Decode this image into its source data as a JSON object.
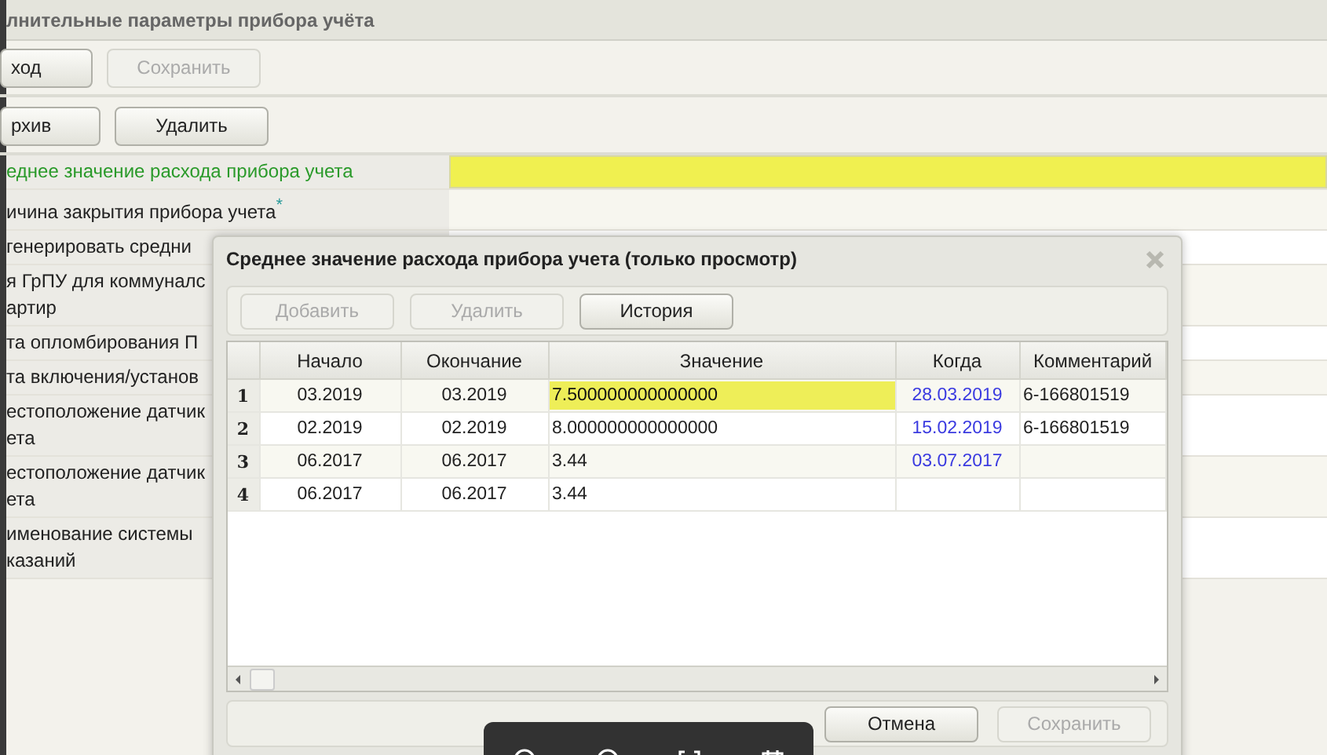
{
  "window": {
    "title": "лнительные параметры прибора учёта"
  },
  "toolbar": [
    {
      "label": "ход",
      "disabled": false
    },
    {
      "label": "Сохранить",
      "disabled": true
    }
  ],
  "toolbar2": [
    {
      "label": "рхив",
      "disabled": false
    },
    {
      "label": "Удалить",
      "disabled": false
    }
  ],
  "properties": [
    {
      "lines": [
        "еднее значение расхода прибора учета"
      ],
      "highlighted": true
    },
    {
      "lines": [
        "ичина закрытия прибора учета"
      ],
      "mark": "*",
      "highlighted": false
    },
    {
      "lines": [
        "генерировать средни"
      ],
      "highlighted": false
    },
    {
      "lines": [
        "я ГрПУ для коммуналс",
        "артир"
      ],
      "highlighted": false
    },
    {
      "lines": [
        "та опломбирования П"
      ],
      "highlighted": false
    },
    {
      "lines": [
        "та включения/установ"
      ],
      "highlighted": false
    },
    {
      "lines": [
        "естоположение датчик",
        "ета"
      ],
      "highlighted": false
    },
    {
      "lines": [
        "естоположение датчик",
        "ета"
      ],
      "highlighted": false
    },
    {
      "lines": [
        "именование системы",
        "казаний"
      ],
      "highlighted": false
    }
  ],
  "dialog": {
    "title": "Среднее значение расхода прибора учета (только просмотр)",
    "buttons": [
      {
        "label": "Добавить",
        "disabled": true
      },
      {
        "label": "Удалить",
        "disabled": true
      },
      {
        "label": "История",
        "disabled": false
      }
    ],
    "table": {
      "columns": [
        "Начало",
        "Окончание",
        "Значение",
        "Когда",
        "Комментарий"
      ],
      "rows": [
        {
          "num": "1",
          "start": "03.2019",
          "end": "03.2019",
          "value": "7.500000000000000",
          "when": "28.03.2019",
          "comment": "6-166801519",
          "selected": true
        },
        {
          "num": "2",
          "start": "02.2019",
          "end": "02.2019",
          "value": "8.000000000000000",
          "when": "15.02.2019",
          "comment": "6-166801519",
          "selected": false
        },
        {
          "num": "3",
          "start": "06.2017",
          "end": "06.2017",
          "value": "3.44",
          "when": "03.07.2017",
          "selected": false
        },
        {
          "num": "4",
          "start": "06.2017",
          "end": "06.2017",
          "value": "3.44",
          "selected": false
        }
      ]
    },
    "footer_buttons": [
      {
        "label": "Отмена",
        "disabled": false
      },
      {
        "label": "Сохранить",
        "disabled": true
      }
    ]
  }
}
